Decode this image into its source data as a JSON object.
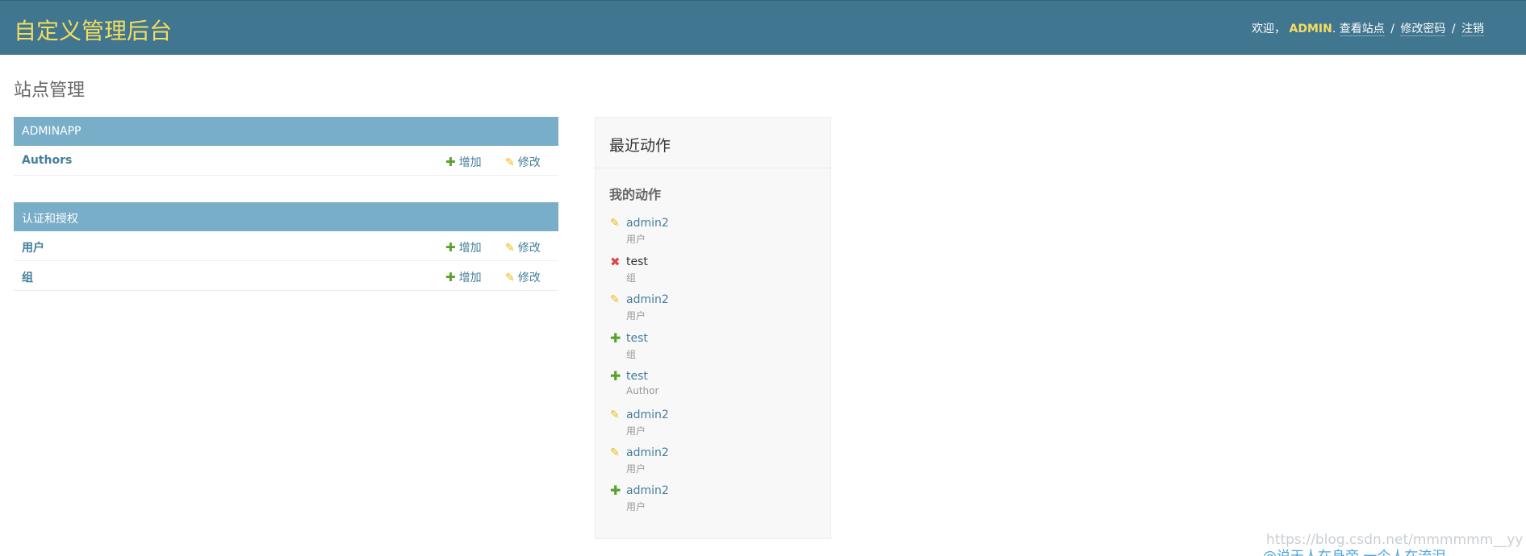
{
  "header": {
    "branding": "自定义管理后台",
    "welcome": "欢迎，",
    "user_name": "ADMIN",
    "view_site": "查看站点",
    "change_password": "修改密码",
    "logout": "注销",
    "separator": "/"
  },
  "page_title": "站点管理",
  "modules": [
    {
      "caption": "ADMINAPP",
      "rows": [
        {
          "label": "Authors",
          "add": "增加",
          "change": "修改"
        }
      ]
    },
    {
      "caption": "认证和授权",
      "rows": [
        {
          "label": "用户",
          "add": "增加",
          "change": "修改"
        },
        {
          "label": "组",
          "add": "增加",
          "change": "修改"
        }
      ]
    }
  ],
  "recent_actions": {
    "title": "最近动作",
    "subtitle": "我的动作",
    "items": [
      {
        "kind": "change",
        "name": "admin2",
        "type": "用户"
      },
      {
        "kind": "delete",
        "name": "test",
        "type": "组"
      },
      {
        "kind": "change",
        "name": "admin2",
        "type": "用户"
      },
      {
        "kind": "add",
        "name": "test",
        "type": "组"
      },
      {
        "kind": "add",
        "name": "test",
        "type": "Author"
      },
      {
        "kind": "change",
        "name": "admin2",
        "type": "用户"
      },
      {
        "kind": "change",
        "name": "admin2",
        "type": "用户"
      },
      {
        "kind": "add",
        "name": "admin2",
        "type": "用户"
      }
    ]
  },
  "watermark": {
    "url": "https://blog.csdn.net/mmmmmm__yy",
    "caption": "@说天人在身旁 一个人在流泪"
  },
  "colors": {
    "header_bg": "#417690",
    "branding": "#f5dd5d",
    "module_caption_bg": "#79aec8",
    "link": "#447e9b",
    "add_icon": "#5aa02c",
    "change_icon": "#efb80b",
    "delete_icon": "#dd4646"
  },
  "icons": {
    "add": "plus-icon",
    "change": "pencil-icon",
    "delete": "delete-x-icon"
  }
}
